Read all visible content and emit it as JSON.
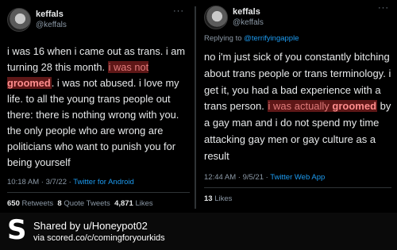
{
  "left_tweet": {
    "name": "keffals",
    "handle": "@keffals",
    "more": "···",
    "text_1": "i was 16 when i came out as trans. i am turning 28 this month. ",
    "text_hl_1": "i was not",
    "text_hl_2": "groomed",
    "text_2": ". i was not abused. i love my life. to all the young trans people out there: there is nothing wrong with you. the only people who are wrong are politicians who want to punish you for being yourself",
    "time": "10:18 AM · 3/7/22 · ",
    "source": "Twitter for Android",
    "retweets_count": "650",
    "retweets_label": "Retweets",
    "quotes_count": "8",
    "quotes_label": "Quote Tweets",
    "likes_count": "4,871",
    "likes_label": "Likes"
  },
  "right_tweet": {
    "name": "keffals",
    "handle": "@keffals",
    "more": "···",
    "replying_label": "Replying to ",
    "replying_to": "@terrifyingapple",
    "text_1": "no i'm just sick of you constantly bitching about trans people or trans terminology. i get it, you had a bad experience with a trans person. ",
    "text_hl_1": "i was actually ",
    "text_hl_2": "groomed",
    "text_2": " by a gay man and i do not spend my time attacking gay men or gay culture as a result",
    "time": "12:44 AM · 9/5/21 · ",
    "source": "Twitter Web App",
    "likes_count": "13",
    "likes_label": "Likes"
  },
  "footer": {
    "logo_glyph": "S",
    "shared_by": "Shared by u/Honeypot02",
    "via": "via scored.co/c/comingforyourkids"
  },
  "colors": {
    "background": "#000000",
    "highlight_bg": "#5e1717",
    "highlight_text": "#ff8d8d",
    "link": "#1d9bf0",
    "muted": "#8b98a5"
  }
}
